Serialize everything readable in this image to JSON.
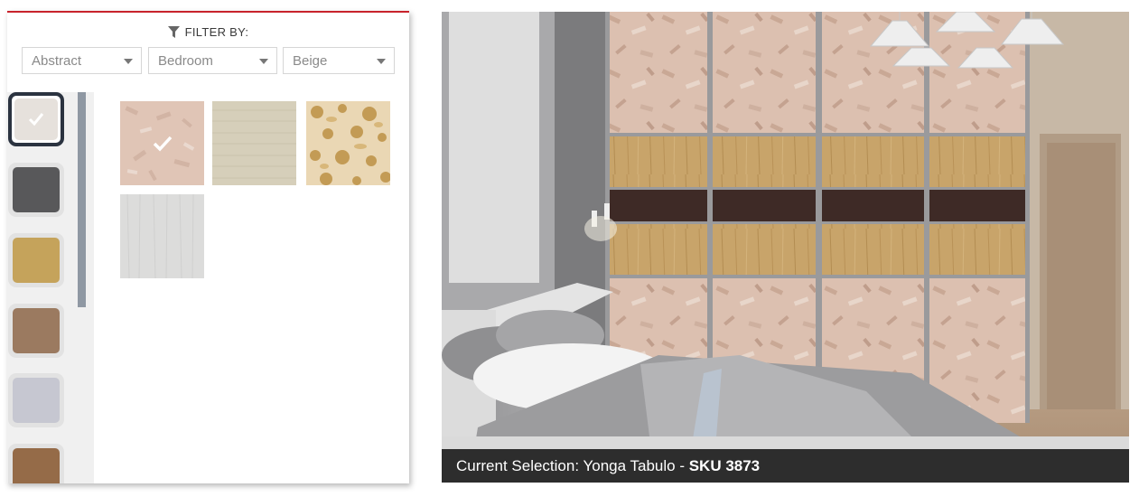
{
  "filter": {
    "heading": "FILTER BY:",
    "style_value": "Abstract",
    "room_value": "Bedroom",
    "color_value": "Beige"
  },
  "color_swatches": [
    {
      "name": "light-beige",
      "color": "#e6e1dc",
      "selected": true
    },
    {
      "name": "dark-gray",
      "color": "#58585a",
      "selected": false
    },
    {
      "name": "gold",
      "color": "#c5a35b",
      "selected": false
    },
    {
      "name": "brown",
      "color": "#9b7a60",
      "selected": false
    },
    {
      "name": "lavender-gray",
      "color": "#c6c7d1",
      "selected": false
    },
    {
      "name": "copper-brown",
      "color": "#956b48",
      "selected": false
    }
  ],
  "texture_tiles": [
    {
      "name": "pink-granite",
      "color": "#e2c7b8",
      "selected": true
    },
    {
      "name": "beige-linen",
      "color": "#d7d0bb",
      "selected": false
    },
    {
      "name": "gold-floral",
      "color": "#c6a465",
      "selected": false
    },
    {
      "name": "light-gray-wood",
      "color": "#dcdcdc",
      "selected": false
    }
  ],
  "selection": {
    "prefix": "Current Selection: ",
    "product_name": "Yonga Tabulo",
    "separator": " - ",
    "sku": "SKU 3873"
  }
}
